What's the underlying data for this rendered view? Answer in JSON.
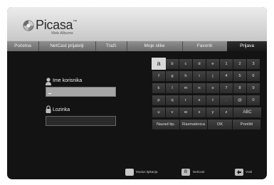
{
  "app": {
    "logo_text": "Picasa",
    "logo_tm": "™",
    "logo_subtitle": "Web Albums"
  },
  "tabs": [
    {
      "label": "Početna",
      "active": false
    },
    {
      "label": "NetCast prijatelji",
      "active": false
    },
    {
      "label": "Traži",
      "active": false
    },
    {
      "label": "Moje slike",
      "active": false
    },
    {
      "label": "Favoriti",
      "active": false
    },
    {
      "label": "Prijava",
      "active": true
    }
  ],
  "login": {
    "username_label": "Ime korisnika",
    "username_value": "",
    "password_label": "Lozinka",
    "password_value": ""
  },
  "keyboard": {
    "rows": [
      [
        "a",
        "b",
        "c",
        "d",
        "e",
        "1",
        "2",
        "3"
      ],
      [
        "f",
        "g",
        "h",
        "i",
        "j",
        "4",
        "5",
        "6"
      ],
      [
        "k",
        "l",
        "m",
        "n",
        "o",
        "7",
        "8",
        "9"
      ],
      [
        "p",
        "q",
        "r",
        "s",
        "t",
        ".",
        "@",
        "0"
      ],
      [
        "u",
        "v",
        "w",
        "x",
        "y",
        "z",
        "ABC"
      ]
    ],
    "selected_key": "a",
    "actions": [
      "Nazad tip.",
      "Razmaknica",
      "OK",
      "Poništi"
    ]
  },
  "footer": {
    "items": [
      {
        "button": "",
        "label": "Modus tipkanja",
        "icon": "yellow-button"
      },
      {
        "button": "B",
        "label": "NetCast",
        "icon": "b-button"
      },
      {
        "button": "",
        "label": "Vrati",
        "icon": "back-button"
      }
    ]
  },
  "colors": {
    "background": "#131313",
    "header": "#dcdcdc",
    "tab_bar": "#7d7d7d",
    "active_tab": "#1f1f1f",
    "selected_key": "#d8d8d8"
  }
}
